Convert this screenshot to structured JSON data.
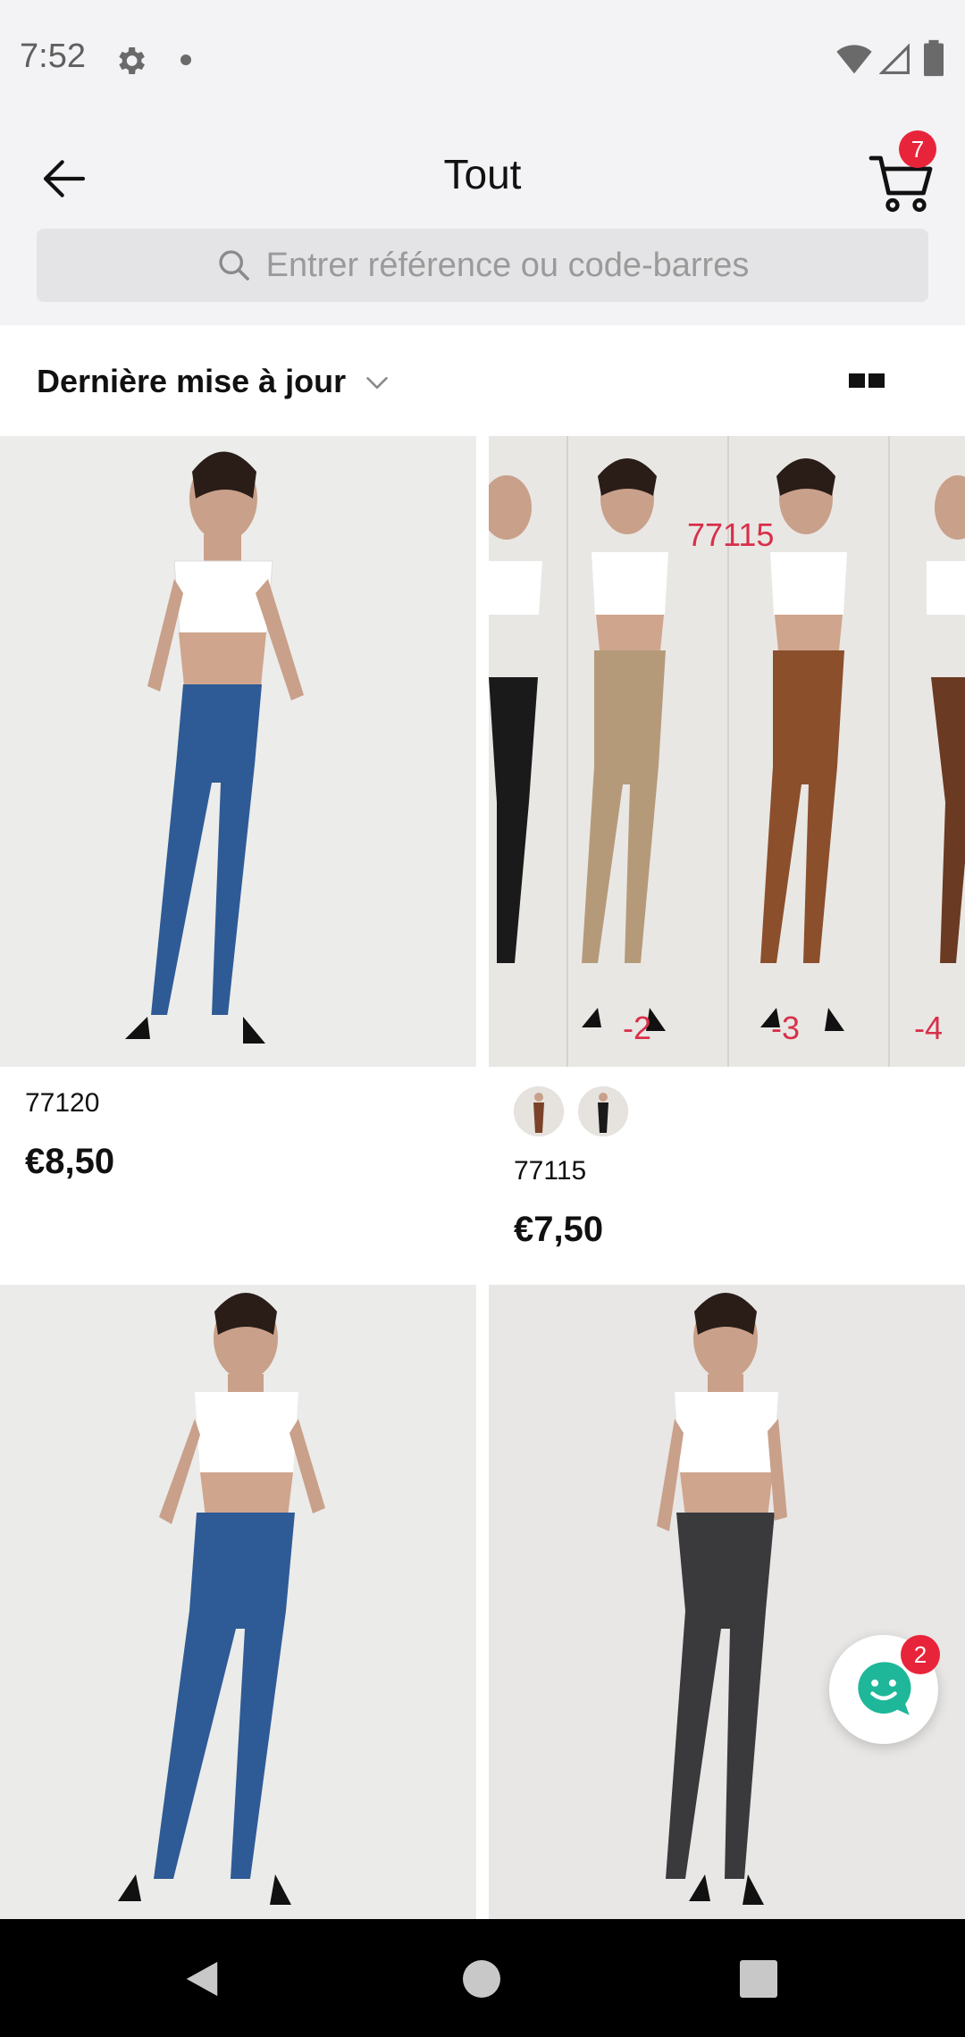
{
  "status_bar": {
    "time": "7:52",
    "icons": [
      "gear-icon",
      "notification-dot",
      "wifi-icon",
      "signal-icon",
      "battery-icon"
    ]
  },
  "header": {
    "title": "Tout",
    "back_icon": "arrow-left-icon",
    "cart_icon": "cart-icon",
    "cart_count": "7"
  },
  "search": {
    "placeholder": "Entrer référence ou code-barres",
    "icon": "search-icon"
  },
  "sort": {
    "label": "Dernière mise à jour",
    "chevron_icon": "chevron-down-icon",
    "view_icon": "grid-view-icon"
  },
  "products": [
    {
      "ref": "77120",
      "price": "€8,50",
      "swatches": []
    },
    {
      "ref": "77115",
      "price": "€7,50",
      "swatches": [
        "brown",
        "black"
      ],
      "image_labels": [
        "77115",
        "-2",
        "-3",
        "-4"
      ]
    },
    {
      "ref": "",
      "price": "",
      "swatches": []
    },
    {
      "ref": "",
      "price": "",
      "swatches": []
    }
  ],
  "chat": {
    "icon": "chat-smile-icon",
    "badge": "2"
  },
  "nav": {
    "icons": [
      "nav-back-icon",
      "nav-home-icon",
      "nav-recent-icon"
    ]
  },
  "colors": {
    "accent_red": "#e8243a",
    "chat_teal": "#1fb79a",
    "header_bg": "#f3f2f4"
  }
}
